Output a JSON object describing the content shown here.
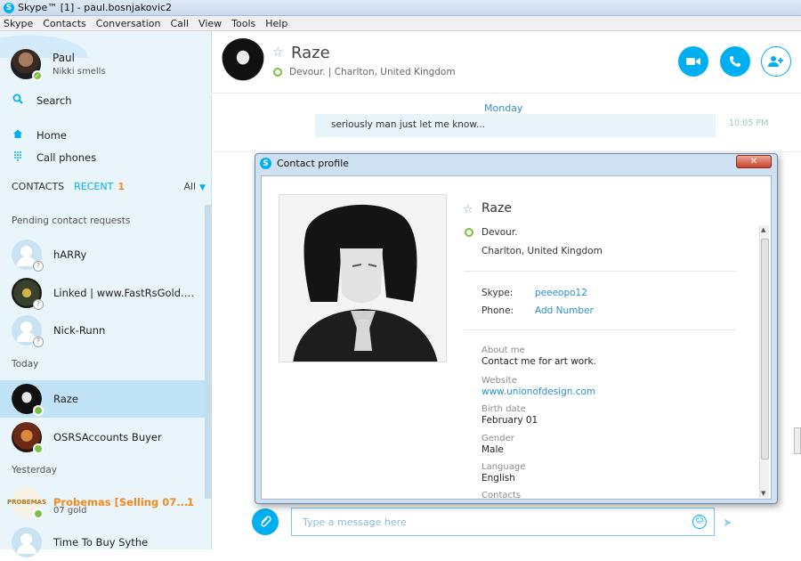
{
  "window": {
    "title": "Skype™ [1] - paul.bosnjakovic2"
  },
  "menu": [
    "Skype",
    "Contacts",
    "Conversation",
    "Call",
    "View",
    "Tools",
    "Help"
  ],
  "profile": {
    "name": "Paul",
    "mood": "Nikki smells"
  },
  "nav": {
    "search": "Search",
    "home": "Home",
    "call_phones": "Call phones"
  },
  "tabs": {
    "contacts": "CONTACTS",
    "recent": "RECENT",
    "recent_count": "1",
    "filter": "All"
  },
  "sections": {
    "pending": "Pending contact requests",
    "today": "Today",
    "yesterday": "Yesterday"
  },
  "contacts": [
    {
      "name": "hARRy"
    },
    {
      "name": "Linked | www.FastRsGold.co..."
    },
    {
      "name": "Nick-Runn"
    },
    {
      "name": "Raze"
    },
    {
      "name": "OSRSAccounts Buyer"
    },
    {
      "name": "Probemas [Selling 07...",
      "badge": "1",
      "sub": "07 gold"
    },
    {
      "name": "Time To Buy Sythe"
    }
  ],
  "conversation": {
    "name": "Raze",
    "mood": "Devour.",
    "location": "Charlton, United Kingdom",
    "day_label": "Monday",
    "message": "seriously man just let me know...",
    "message_time": "10:05 PM",
    "input_placeholder": "Type a message here"
  },
  "dialog": {
    "title": "Contact profile",
    "name": "Raze",
    "mood": "Devour.",
    "location": "Charlton, United Kingdom",
    "skype_label": "Skype:",
    "skype_value": "peeeopo12",
    "phone_label": "Phone:",
    "phone_value": "Add Number",
    "about_label": "About me",
    "about_value": "Contact me for art work.",
    "website_label": "Website",
    "website_value": "www.unionofdesign.com",
    "birth_label": "Birth date",
    "birth_value": "February 01",
    "gender_label": "Gender",
    "gender_value": "Male",
    "language_label": "Language",
    "language_value": "English",
    "contacts_label": "Contacts"
  },
  "colors": {
    "accent": "#00aff0",
    "orange": "#f38a1d",
    "online": "#7bc043"
  }
}
